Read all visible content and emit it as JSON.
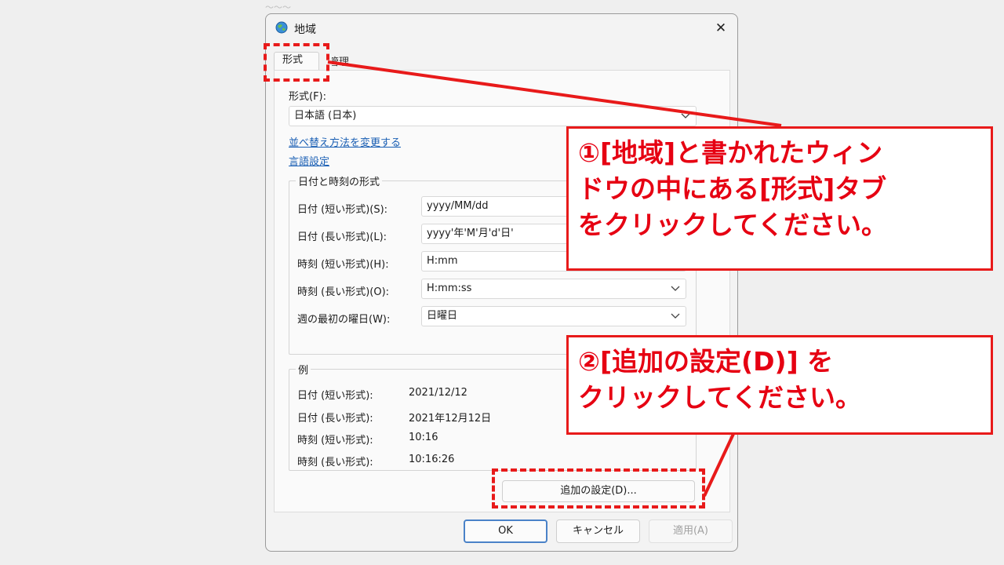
{
  "window": {
    "title": "地域",
    "close_glyph": "✕"
  },
  "tabs": [
    {
      "label": "形式",
      "active": true
    },
    {
      "label": "管理",
      "active": false
    }
  ],
  "format": {
    "label": "形式(F):",
    "value": "日本語 (日本)"
  },
  "links": {
    "sort": "並べ替え方法を変更する",
    "language": "言語設定"
  },
  "datetime_group": {
    "title": "日付と時刻の形式",
    "rows": [
      {
        "label": "日付 (短い形式)(S):",
        "value": "yyyy/MM/dd"
      },
      {
        "label": "日付 (長い形式)(L):",
        "value": "yyyy'年'M'月'd'日'"
      },
      {
        "label": "時刻 (短い形式)(H):",
        "value": "H:mm"
      },
      {
        "label": "時刻 (長い形式)(O):",
        "value": "H:mm:ss"
      },
      {
        "label": "週の最初の曜日(W):",
        "value": "日曜日"
      }
    ]
  },
  "examples": {
    "title": "例",
    "rows": [
      {
        "label": "日付 (短い形式):",
        "value": "2021/12/12"
      },
      {
        "label": "日付 (長い形式):",
        "value": "2021年12月12日"
      },
      {
        "label": "時刻 (短い形式):",
        "value": "10:16"
      },
      {
        "label": "時刻 (長い形式):",
        "value": "10:16:26"
      }
    ]
  },
  "buttons": {
    "additional": "追加の設定(D)...",
    "ok": "OK",
    "cancel": "キャンセル",
    "apply": "適用(A)"
  },
  "callouts": {
    "one": [
      "①[地域]と書かれたウィン",
      "ドウの中にある[形式]タブ",
      "をクリックしてください。"
    ],
    "two": [
      "②[追加の設定(D)] を",
      "クリックしてください。"
    ]
  },
  "colors": {
    "annotation": "#e81a1a",
    "link": "#1a5fb4",
    "primary_border": "#4a82c8"
  }
}
